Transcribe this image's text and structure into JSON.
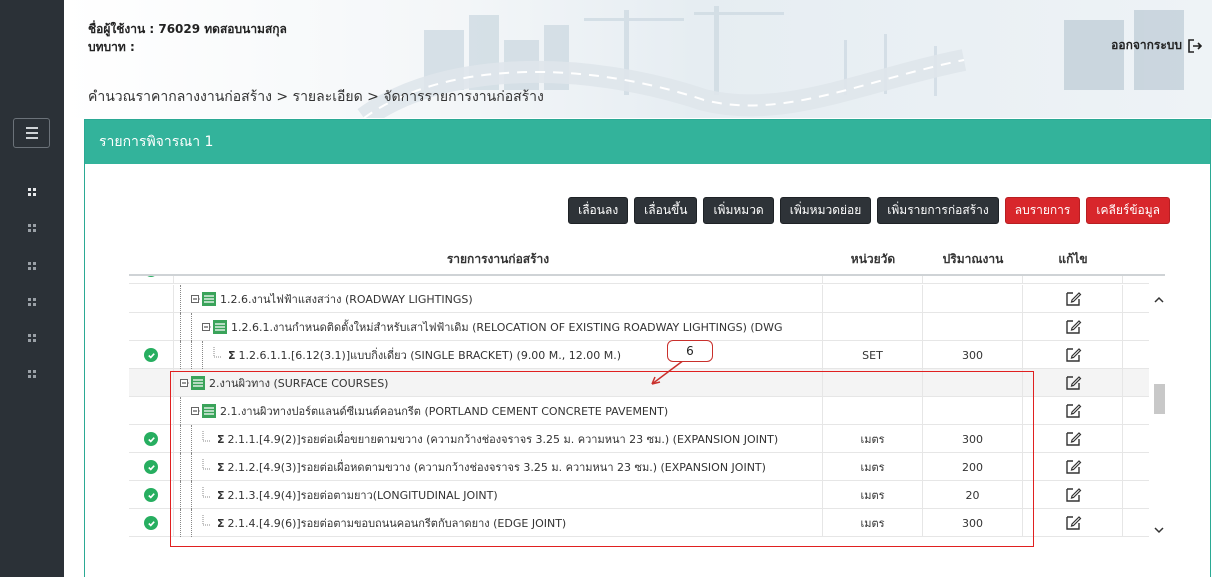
{
  "header": {
    "user_label": "ชื่อผู้ใช้งาน : 76029 ทดสอบนามสกุล",
    "role_label": "บทบาท :",
    "logout_label": "ออกจากระบบ",
    "breadcrumb": "คำนวณราคากลางงานก่อสร้าง > รายละเอียด > จัดการรายการงานก่อสร้าง"
  },
  "sidebar": {
    "items": [
      "grid-icon",
      "grid-icon",
      "grid-icon",
      "grid-icon",
      "grid-icon",
      "grid-icon"
    ]
  },
  "panel": {
    "title": "รายการพิจารณา 1"
  },
  "toolbar": {
    "move_down": "เลื่อนลง",
    "move_up": "เลื่อนขึ้น",
    "add_category": "เพิ่มหมวด",
    "add_subcategory": "เพิ่มหมวดย่อย",
    "add_item": "เพิ่มรายการก่อสร้าง",
    "delete_item": "ลบรายการ",
    "clear_data": "เคลียร์ข้อมูล"
  },
  "table": {
    "columns": {
      "name": "รายการงานก่อสร้าง",
      "unit": "หน่วยวัด",
      "qty": "ปริมาณงาน",
      "edit": "แก้ไข"
    },
    "rows": [
      {
        "level": 1,
        "type": "folder",
        "checked": false,
        "name": "1.2.6.งานไฟฟ้าแสงสว่าง (ROADWAY LIGHTINGS)",
        "unit": "",
        "qty": ""
      },
      {
        "level": 2,
        "type": "folder",
        "checked": false,
        "name": "1.2.6.1.งานกำหนดติดตั้งใหม่สำหรับเสาไฟฟ้าเดิม (RELOCATION OF EXISTING ROADWAY LIGHTINGS) (DWG",
        "unit": "",
        "qty": ""
      },
      {
        "level": 3,
        "type": "item",
        "checked": true,
        "name": "1.2.6.1.1.[6.12(3.1)]แบบกิ่งเดี่ยว (SINGLE BRACKET) (9.00 M., 12.00 M.)",
        "unit": "SET",
        "qty": "300"
      },
      {
        "level": 0,
        "type": "folder",
        "checked": false,
        "name": "2.งานผิวทาง (SURFACE COURSES)",
        "unit": "",
        "qty": ""
      },
      {
        "level": 1,
        "type": "folder",
        "checked": false,
        "name": "2.1.งานผิวทางปอร์ตแลนด์ซีเมนต์คอนกรีต (PORTLAND CEMENT CONCRETE PAVEMENT)",
        "unit": "",
        "qty": ""
      },
      {
        "level": 2,
        "type": "item",
        "checked": true,
        "name": "2.1.1.[4.9(2)]รอยต่อเผื่อขยายตามขวาง (ความกว้างช่องจราจร 3.25 ม. ความหนา 23 ซม.) (EXPANSION JOINT)",
        "unit": "เมตร",
        "qty": "300"
      },
      {
        "level": 2,
        "type": "item",
        "checked": true,
        "name": "2.1.2.[4.9(3)]รอยต่อเผื่อหดตามขวาง (ความกว้างช่องจราจร 3.25 ม. ความหนา 23 ซม.) (EXPANSION JOINT)",
        "unit": "เมตร",
        "qty": "200"
      },
      {
        "level": 2,
        "type": "item",
        "checked": true,
        "name": "2.1.3.[4.9(4)]รอยต่อตามยาว(LONGITUDINAL JOINT)",
        "unit": "เมตร",
        "qty": "20"
      },
      {
        "level": 2,
        "type": "item",
        "checked": true,
        "name": "2.1.4.[4.9(6)]รอยต่อตามขอบถนนคอนกรีตกับลาดยาง (EDGE JOINT)",
        "unit": "เมตร",
        "qty": "300"
      }
    ]
  },
  "annotation": {
    "label": "6"
  },
  "colors": {
    "panel_header": "#33b39b",
    "sidebar": "#2b3137",
    "dark_button": "#2e3338",
    "red_button": "#d8262b",
    "check": "#27ae60",
    "annotation": "#e02020"
  }
}
